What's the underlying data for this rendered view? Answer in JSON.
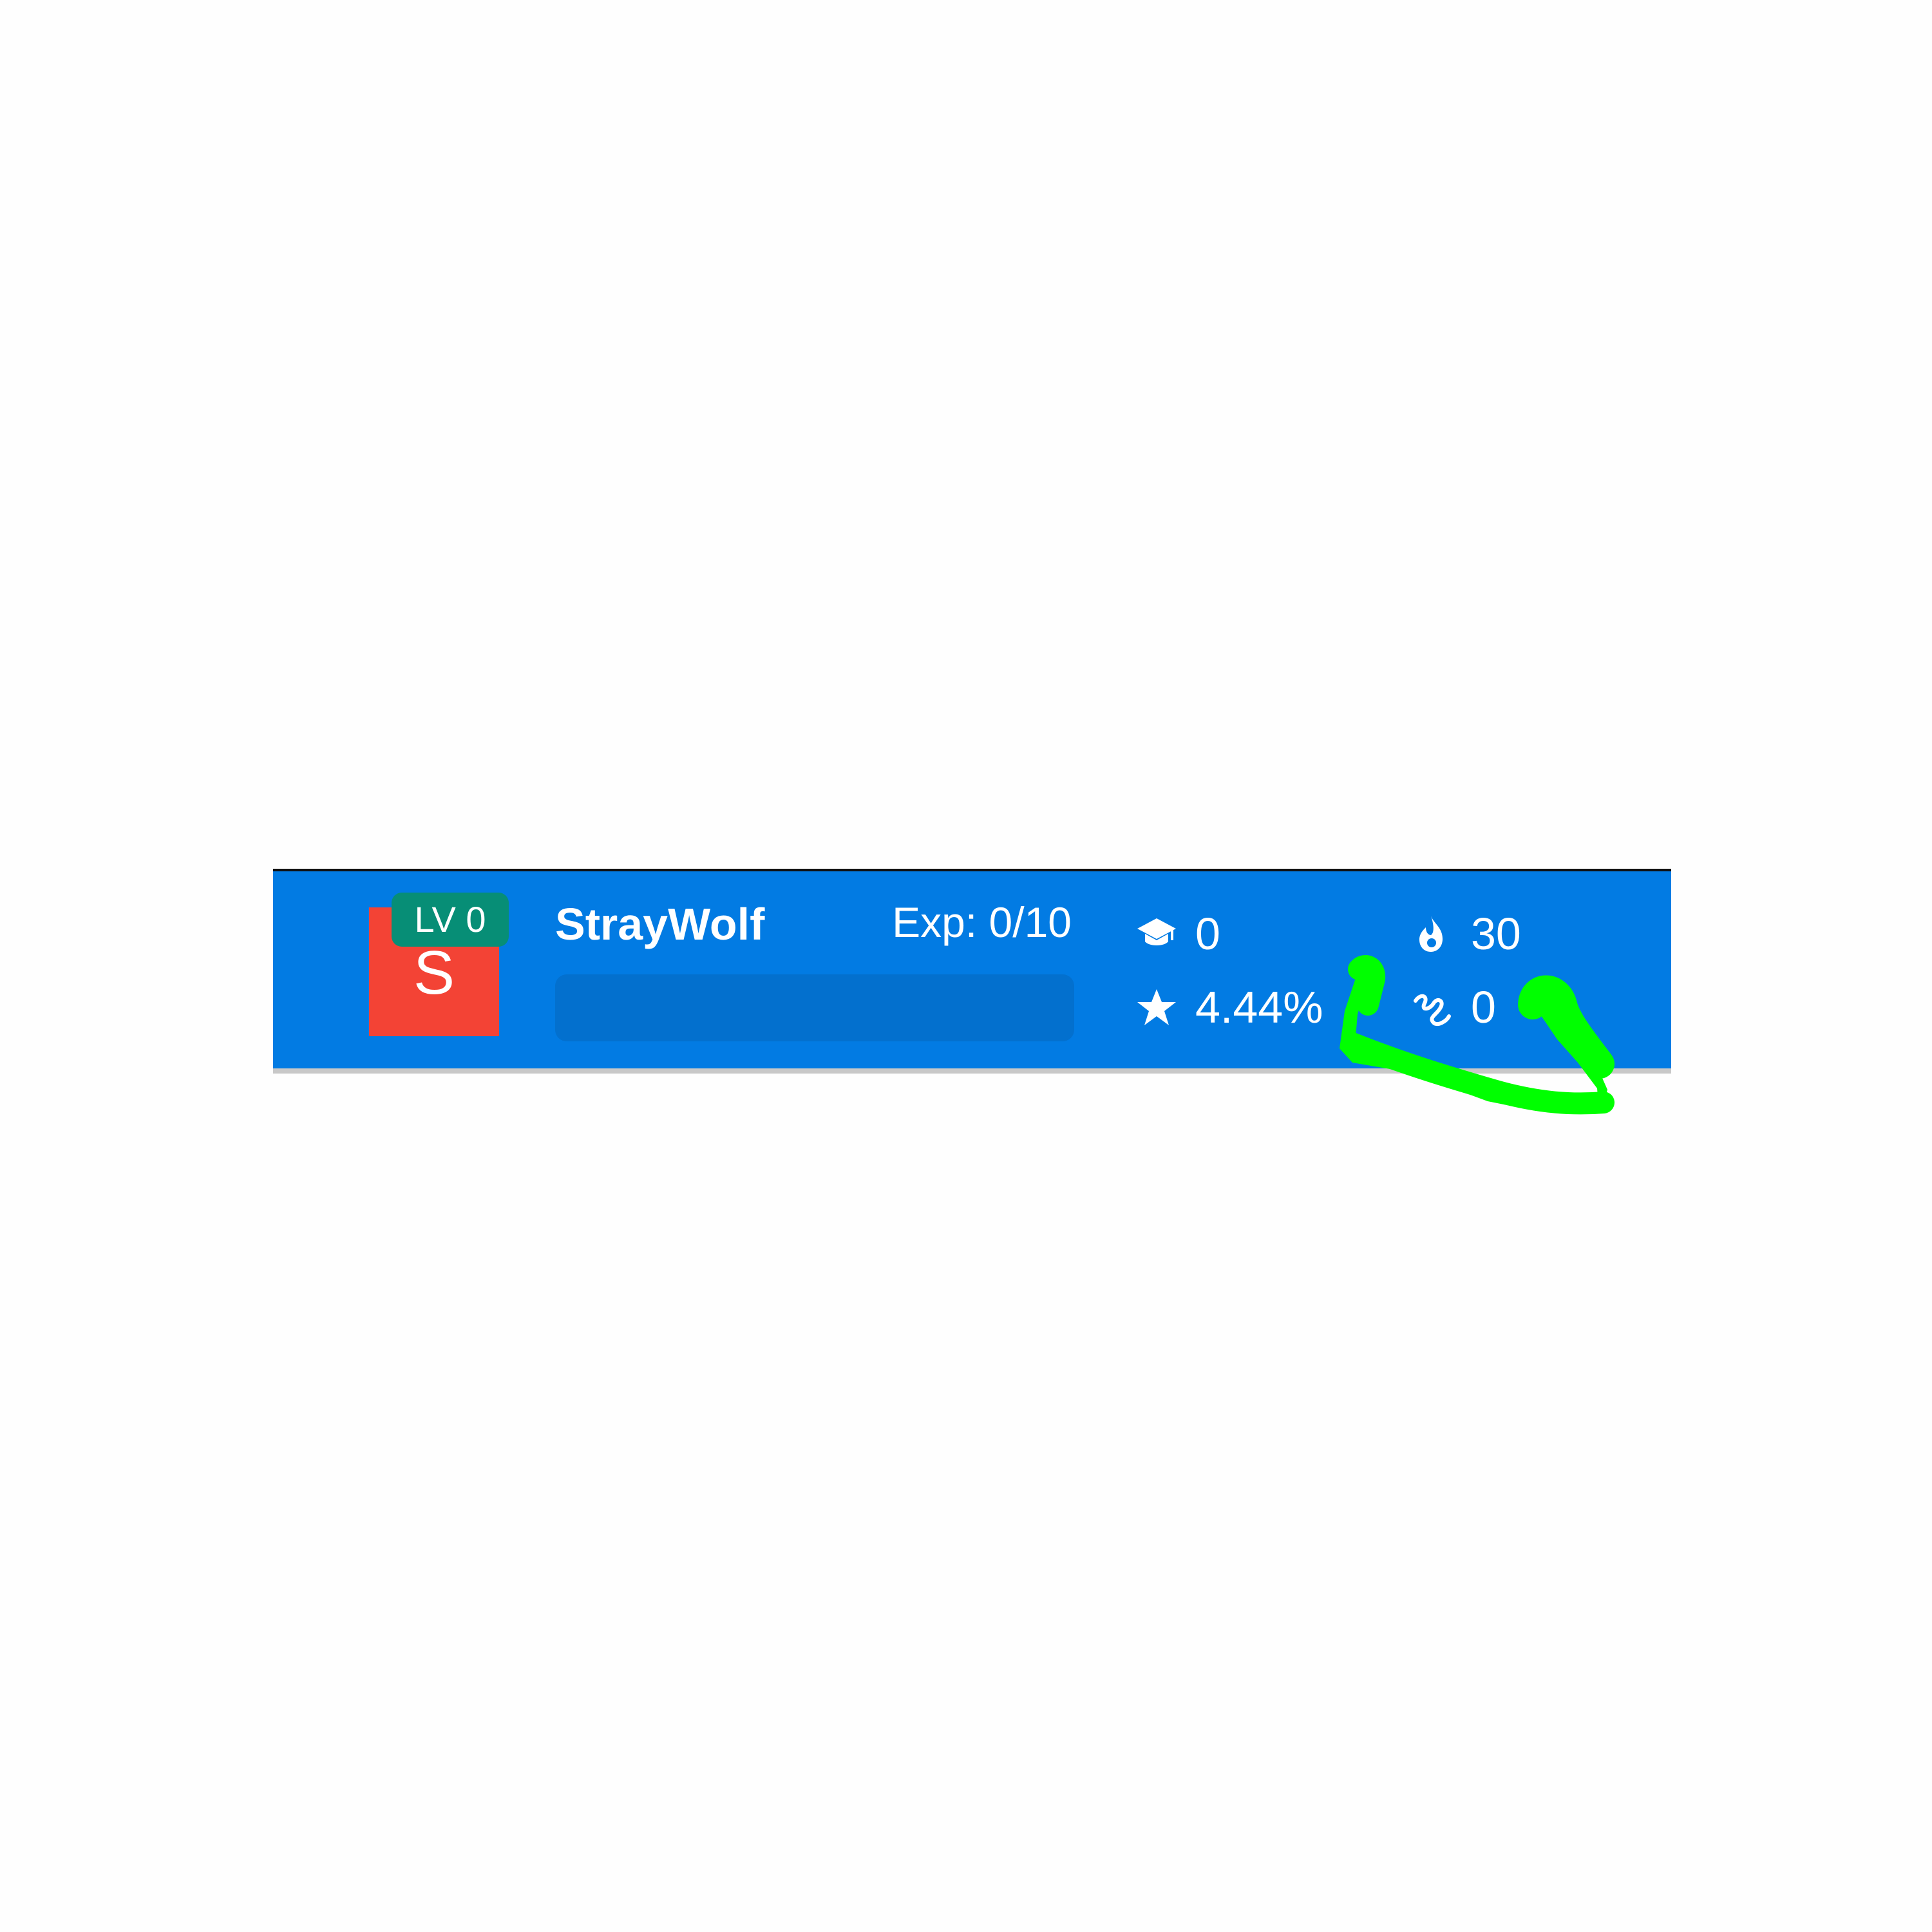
{
  "profile": {
    "level_label": "LV 0",
    "avatar_letter": "S",
    "username": "StrayWolf",
    "exp_text": "Exp: 0/10",
    "exp_progress": 0
  },
  "stats": {
    "courses": "0",
    "accuracy": "4.44%",
    "streak": "30",
    "signature": "0"
  },
  "icons": {
    "courses": "graduation-cap-icon",
    "accuracy": "star-icon",
    "streak": "fire-icon",
    "signature": "squiggle-icon"
  },
  "colors": {
    "bar": "#027be3",
    "avatar": "#f34335",
    "level_badge": "#078e76",
    "exp_track": "#0370ce",
    "annotation": "#00ff00"
  }
}
